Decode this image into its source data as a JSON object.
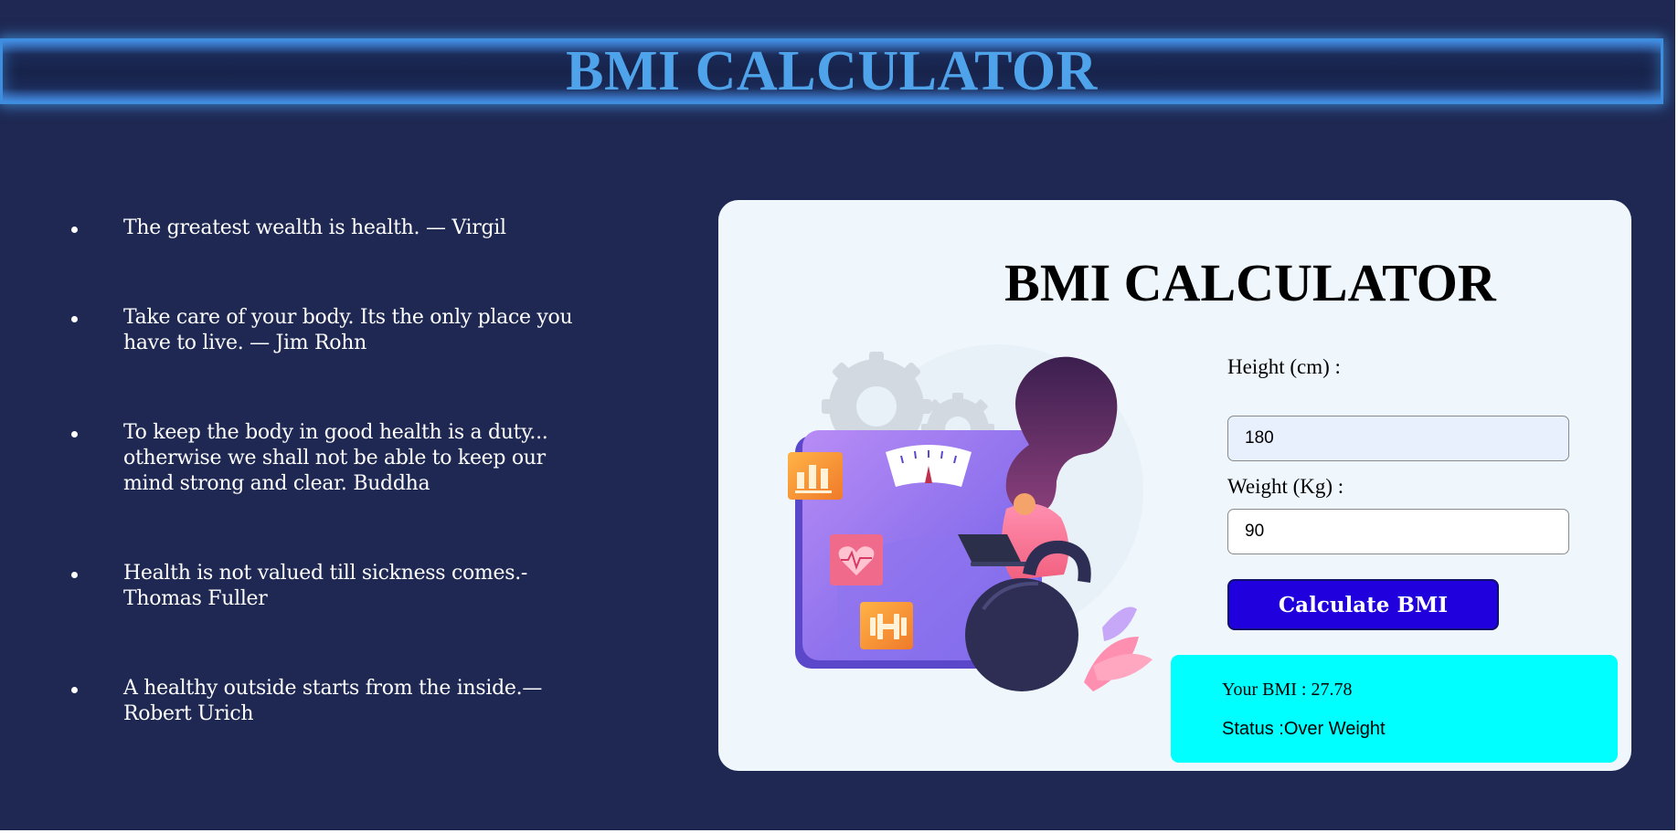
{
  "banner": {
    "title": "BMI CALCULATOR"
  },
  "quotes": [
    "The greatest wealth is health. — Virgil",
    "Take care of your body. Its the only place you have to live. — Jim Rohn",
    "To keep the body in good health is a duty... otherwise we shall not be able to keep our mind strong and clear. Buddha",
    "Health is not valued till sickness comes.- Thomas Fuller",
    "A healthy outside starts from the inside.— Robert Urich"
  ],
  "card": {
    "title": "BMI CALCULATOR",
    "height_label": "Height (cm) :",
    "height_value": "180",
    "weight_label": "Weight (Kg) :",
    "weight_value": "90",
    "button_label": "Calculate BMI",
    "result": {
      "bmi_text": "Your BMI : 27.78",
      "status_text": "Status :Over Weight"
    }
  },
  "colors": {
    "page_background": "#1e2852",
    "banner_title": "#4fa3ea",
    "card_background": "#eff7fd",
    "button_background": "#2000dc",
    "result_background": "#00ffff",
    "height_input_background": "#e8f0fe",
    "weight_input_background": "#ffffff"
  },
  "icons": [
    "gear-icon",
    "bar-chart-icon",
    "heart-rate-icon",
    "dumbbell-icon",
    "scale-dial-icon",
    "laptop-icon"
  ]
}
